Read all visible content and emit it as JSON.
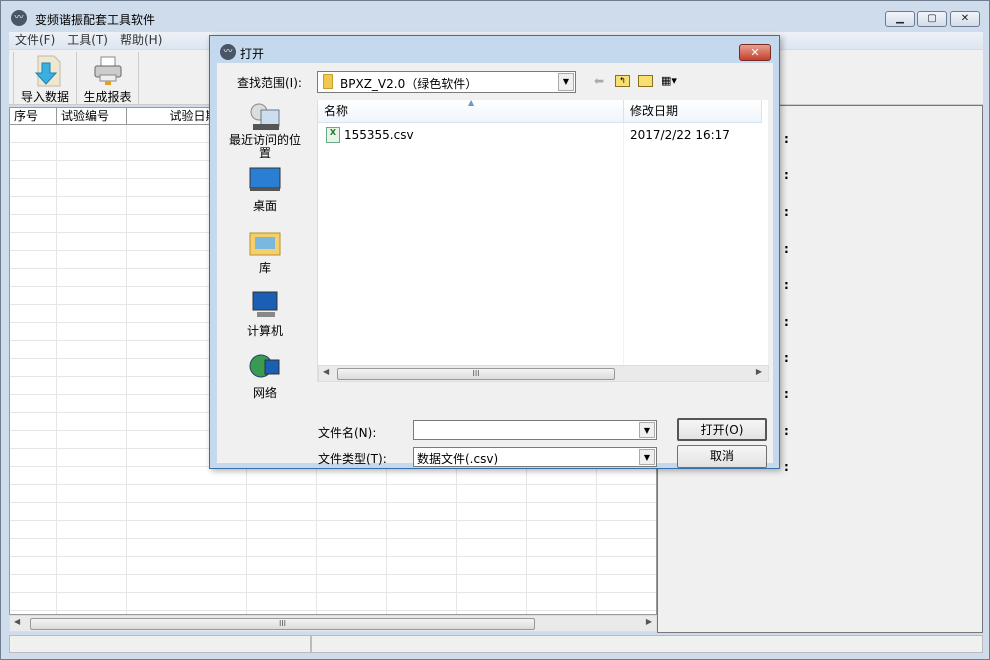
{
  "app": {
    "title": "变频谐振配套工具软件",
    "icon": "waveform-icon",
    "minimize": "minimize-icon",
    "maximize": "maximize-icon",
    "close": "close-icon"
  },
  "menu": [
    "文件(F)",
    "工具(T)",
    "帮助(H)"
  ],
  "toolbar": {
    "import": "导入数据",
    "report": "生成报表"
  },
  "table": {
    "columns": [
      "序号",
      "试验编号",
      "试验日期"
    ]
  },
  "dialog": {
    "title": "打开",
    "look_in_label": "查找范围(I):",
    "look_in_value": "BPXZ_V2.0（绿色软件）",
    "places": [
      "最近访问的位置",
      "桌面",
      "库",
      "计算机",
      "网络"
    ],
    "columns": [
      "名称",
      "修改日期"
    ],
    "files": [
      {
        "name": "155355.csv",
        "modified": "2017/2/22 16:17"
      }
    ],
    "filename_label": "文件名(N):",
    "filename_value": "",
    "filetype_label": "文件类型(T):",
    "filetype_value": "数据文件(.csv)",
    "open_button": "打开(O)",
    "cancel_button": "取消"
  },
  "colors": {
    "title_bg": "#cfdcec",
    "close_red": "#c4402c",
    "panel": "#f0f0f0"
  }
}
